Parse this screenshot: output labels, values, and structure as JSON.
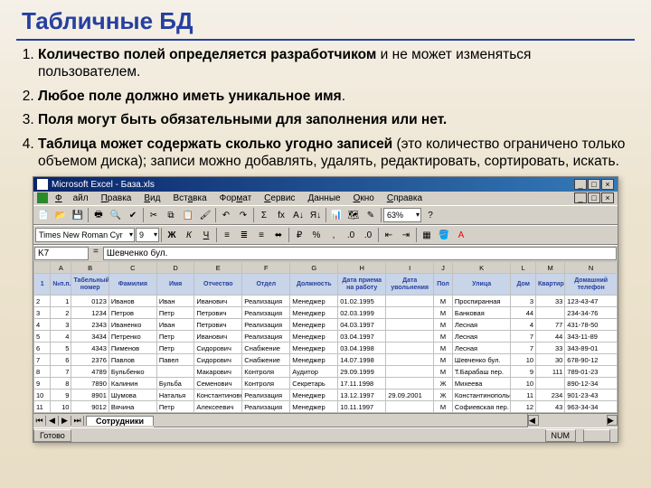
{
  "slide": {
    "title": "Табличные БД",
    "rules": [
      {
        "bold": "Количество полей определяется разработчиком",
        "rest": " и не может изменяться пользователем."
      },
      {
        "bold": "Любое поле должно иметь уникальное имя",
        "rest": "."
      },
      {
        "bold": "Поля могут быть обязательными для заполнения или нет.",
        "rest": ""
      },
      {
        "bold": "Таблица может содержать сколько угодно записей",
        "rest": " (это количество ограничено только объемом диска); записи можно добавлять, удалять, редактировать, сортировать, искать."
      }
    ]
  },
  "excel": {
    "title": "Microsoft Excel - База.xls",
    "menus": [
      "Файл",
      "Правка",
      "Вид",
      "Вставка",
      "Формат",
      "Сервис",
      "Данные",
      "Окно",
      "Справка"
    ],
    "zoom": "63%",
    "font_name": "Times New Roman Cyr",
    "font_size": "9",
    "name_box": "K7",
    "formula": "Шевченко бул.",
    "col_letters": [
      "A",
      "B",
      "C",
      "D",
      "E",
      "F",
      "G",
      "H",
      "I",
      "J",
      "K",
      "L",
      "M",
      "N"
    ],
    "headers": [
      "№п.п.",
      "Табельный номер",
      "Фамилия",
      "Имя",
      "Отчество",
      "Отдел",
      "Должность",
      "Дата приема на работу",
      "Дата увольнения",
      "Пол",
      "Улица",
      "Дом",
      "Квартира",
      "Домашний телефон"
    ],
    "rows": [
      [
        "1",
        "0123",
        "Иванов",
        "Иван",
        "Иванович",
        "Реализация",
        "Менеджер",
        "01.02.1995",
        "",
        "М",
        "Проспиранная",
        "3",
        "33",
        "123-43-47"
      ],
      [
        "2",
        "1234",
        "Петров",
        "Петр",
        "Петрович",
        "Реализация",
        "Менеджер",
        "02.03.1999",
        "",
        "М",
        "Банковая",
        "44",
        "",
        "234-34-76"
      ],
      [
        "3",
        "2343",
        "Иваненко",
        "Иван",
        "Петрович",
        "Реализация",
        "Менеджер",
        "04.03.1997",
        "",
        "М",
        "Лесная",
        "4",
        "77",
        "431-78-50"
      ],
      [
        "4",
        "3434",
        "Петренко",
        "Петр",
        "Иванович",
        "Реализация",
        "Менеджер",
        "03.04.1997",
        "",
        "М",
        "Лесная",
        "7",
        "44",
        "343-11-89"
      ],
      [
        "5",
        "4343",
        "Пименов",
        "Петр",
        "Сидорович",
        "Снабжение",
        "Менеджер",
        "03.04.1998",
        "",
        "М",
        "Лесная",
        "7",
        "33",
        "343-89-01"
      ],
      [
        "6",
        "2376",
        "Павлов",
        "Павел",
        "Сидорович",
        "Снабжение",
        "Менеджер",
        "14.07.1998",
        "",
        "М",
        "Шевченко бул.",
        "10",
        "30",
        "678-90-12"
      ],
      [
        "7",
        "4789",
        "Бульбенко",
        "",
        "Макарович",
        "Контроля",
        "Аудитор",
        "29.09.1999",
        "",
        "М",
        "Т.Барабаш пер.",
        "9",
        "111",
        "789-01-23"
      ],
      [
        "8",
        "7890",
        "Калинин",
        "Бульба",
        "Семенович",
        "Контроля",
        "Секретарь",
        "17.11.1998",
        "",
        "Ж",
        "Михеева",
        "10",
        "",
        "890-12-34"
      ],
      [
        "9",
        "8901",
        "Шумова",
        "Наталья",
        "Константиновна",
        "Реализация",
        "Менеджер",
        "13.12.1997",
        "29.09.2001",
        "Ж",
        "Константинопольская",
        "11",
        "234",
        "901-23-43"
      ],
      [
        "10",
        "9012",
        "Вячина",
        "Петр",
        "Алексеевич",
        "Реализация",
        "Менеджер",
        "10.11.1997",
        "",
        "М",
        "Софиевская пер.",
        "12",
        "43",
        "963-34-34"
      ]
    ],
    "sheet_tab": "Сотрудники",
    "status_ready": "Готово",
    "status_num": "NUM"
  }
}
